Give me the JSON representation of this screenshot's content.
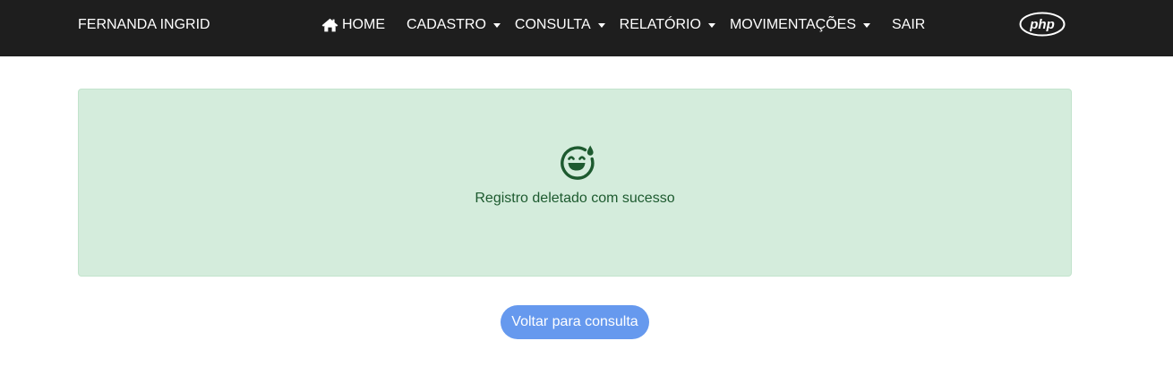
{
  "navbar": {
    "brand": "FERNANDA INGRID",
    "items": [
      {
        "label": "HOME",
        "icon": "home-icon",
        "dropdown": false
      },
      {
        "label": "CADASTRO",
        "dropdown": true
      },
      {
        "label": "CONSULTA",
        "dropdown": true
      },
      {
        "label": "RELATÓRIO",
        "dropdown": true
      },
      {
        "label": "MOVIMENTAÇÕES",
        "dropdown": true
      },
      {
        "label": "SAIR",
        "dropdown": false
      }
    ],
    "logo": "php",
    "background": "#1e1e1e"
  },
  "alert": {
    "icon": "grinning-sweat-icon",
    "message": "Registro deletado com sucesso",
    "background": "#d4ecdc",
    "text_color": "#1d5a2f"
  },
  "back_button": {
    "label": "Voltar para consulta",
    "color": "#6699ee"
  }
}
